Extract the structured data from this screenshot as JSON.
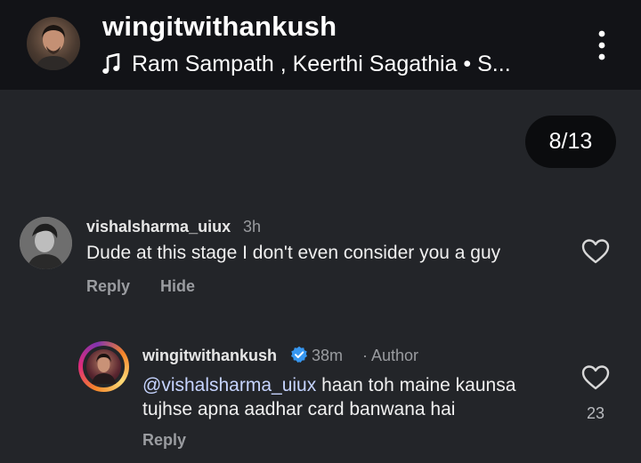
{
  "header": {
    "username": "wingitwithankush",
    "audio_icon": "music-note-icon",
    "audio_text": "Ram Sampath , Keerthi Sagathia • S...",
    "menu_icon": "more-vertical-icon"
  },
  "slide_counter": "8/13",
  "comment": {
    "username": "vishalsharma_uiux",
    "time": "3h",
    "text": "Dude at this stage I don't even consider you a guy",
    "reply_label": "Reply",
    "hide_label": "Hide",
    "like_icon": "heart-icon"
  },
  "reply": {
    "username": "wingitwithankush",
    "verified_icon": "verified-badge-icon",
    "time": "38m",
    "author_label": "· Author",
    "mention": "@vishalsharma_uiux",
    "text": " haan toh maine kaunsa tujhse apna aadhar card banwana hai",
    "reply_label": "Reply",
    "like_icon": "heart-icon",
    "like_count": "23"
  },
  "colors": {
    "background": "#232529",
    "header_background": "#121317",
    "muted_text": "#9a9ca0",
    "verified_blue": "#3797f0",
    "mention": "#c6d4ff"
  }
}
